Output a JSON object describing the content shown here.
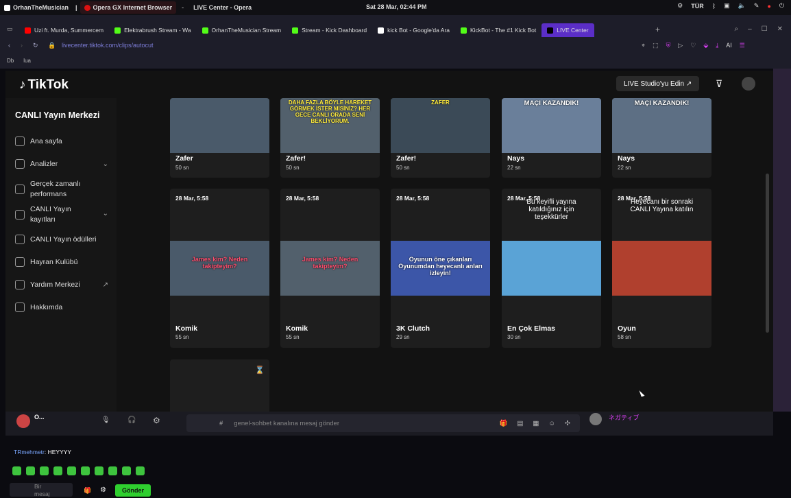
{
  "os": {
    "app_name": "OrhanTheMusician",
    "sep": "|",
    "browser_name": "Opera GX Internet Browser",
    "dash": "-",
    "window_title": "LIVE Center - Opera",
    "clock": "Sat 28 Mar, 02:44 PM",
    "lang": "TÜR"
  },
  "tabs": [
    {
      "label": "Uzi ft. Murda, Summercem",
      "color": "#ff0000"
    },
    {
      "label": "Elektrabrush Stream - Wa",
      "color": "#53fc18"
    },
    {
      "label": "OrhanTheMusician Stream",
      "color": "#53fc18"
    },
    {
      "label": "Stream - Kick Dashboard",
      "color": "#53fc18"
    },
    {
      "label": "kick Bot - Google'da Ara",
      "color": "#ffffff"
    },
    {
      "label": "KickBot - The #1 Kick Bot",
      "color": "#53fc18"
    },
    {
      "label": "LIVE Center",
      "color": "#000000"
    }
  ],
  "address": {
    "url": "livecenter.tiktok.com/clips/autocut",
    "ai": "AI"
  },
  "bookmarks": [
    "Db",
    "lua"
  ],
  "tiktok": {
    "brand": "TikTok",
    "studio_btn": "LIVE Studio'yu Edin ↗",
    "sidebar_title": "CANLI Yayın Merkezi",
    "nav": [
      {
        "label": "Ana sayfa"
      },
      {
        "label": "Analizler"
      },
      {
        "label": "Gerçek zamanlı performans"
      },
      {
        "label": "CANLI Yayın kayıtları"
      },
      {
        "label": "CANLI Yayın ödülleri"
      },
      {
        "label": "Hayran Kulübü"
      },
      {
        "label": "Yardım Merkezi"
      },
      {
        "label": "Hakkımda"
      }
    ]
  },
  "clips_row1": [
    {
      "title": "Zafer",
      "duration": "50 sn",
      "caption": ""
    },
    {
      "title": "Zafer!",
      "duration": "50 sn",
      "caption": "DAHA FAZLA BÖYLE HAREKET GÖRMEK İSTER MİSİNİZ? HER GECE CANLI ORADA SENİ BEKLİYORUM."
    },
    {
      "title": "Zafer!",
      "duration": "50 sn",
      "caption": "ZAFER"
    },
    {
      "title": "Nays",
      "duration": "22 sn",
      "caption": "MAÇI KAZANDIK!"
    },
    {
      "title": "Nays",
      "duration": "22 sn",
      "caption": "MAÇI KAZANDIK!"
    }
  ],
  "clips_row2": [
    {
      "date": "28 Mar, 5:58",
      "title": "Komik",
      "duration": "55 sn",
      "caption": "James kim? Neden takipteyim?",
      "top_text": ""
    },
    {
      "date": "28 Mar, 5:58",
      "title": "Komik",
      "duration": "55 sn",
      "caption": "James kim? Neden takipteyim?",
      "top_text": ""
    },
    {
      "date": "28 Mar, 5:58",
      "title": "3K Clutch",
      "duration": "29 sn",
      "caption": "Oyunun öne çıkanları Oyunumdan heyecanlı anları izleyin!",
      "top_text": ""
    },
    {
      "date": "28 Mar, 5:58",
      "title": "En Çok Elmas",
      "duration": "30 sn",
      "caption": "",
      "top_text": "Bu keyifli yayına katıldığınız için teşekkürler"
    },
    {
      "date": "28 Mar, 5:58",
      "title": "Oyun",
      "duration": "58 sn",
      "caption": "",
      "top_text": "Heyecanı bir sonraki CANLI Yayına katılın"
    }
  ],
  "discord": {
    "user": "O...",
    "placeholder": "genel-sohbet kanalına mesaj gönder",
    "right_user": "ネガティブ",
    "chat_user": "TRmehmetr",
    "chat_text": ": HEYYYY",
    "input_placeholder": "Bir mesaj",
    "send": "Gönder"
  }
}
